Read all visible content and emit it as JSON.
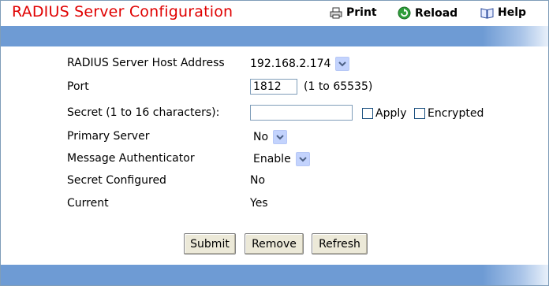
{
  "header": {
    "title": "RADIUS Server Configuration",
    "print_label": "Print",
    "reload_label": "Reload",
    "help_label": "Help",
    "icons": {
      "print": "printer-icon",
      "reload": "reload-icon",
      "help": "help-book-icon"
    }
  },
  "form": {
    "host": {
      "label": "RADIUS Server Host Address",
      "value": "192.168.2.174"
    },
    "port": {
      "label": "Port",
      "value": "1812",
      "range": "(1 to 65535)"
    },
    "secret": {
      "label": "Secret (1 to 16 characters):",
      "value": "",
      "apply_label": "Apply",
      "encrypted_label": "Encrypted"
    },
    "primary": {
      "label": "Primary Server",
      "value": "No"
    },
    "msg_auth": {
      "label": "Message Authenticator",
      "value": "Enable"
    },
    "secret_configured": {
      "label": "Secret Configured",
      "value": "No"
    },
    "current": {
      "label": "Current",
      "value": "Yes"
    }
  },
  "buttons": {
    "submit": "Submit",
    "remove": "Remove",
    "refresh": "Refresh"
  },
  "colors": {
    "title": "#e00000",
    "band": "#6e9bd4",
    "dropdown_arrow_bg": "#c3d3fd",
    "reload_icon": "#2e9e3a"
  }
}
